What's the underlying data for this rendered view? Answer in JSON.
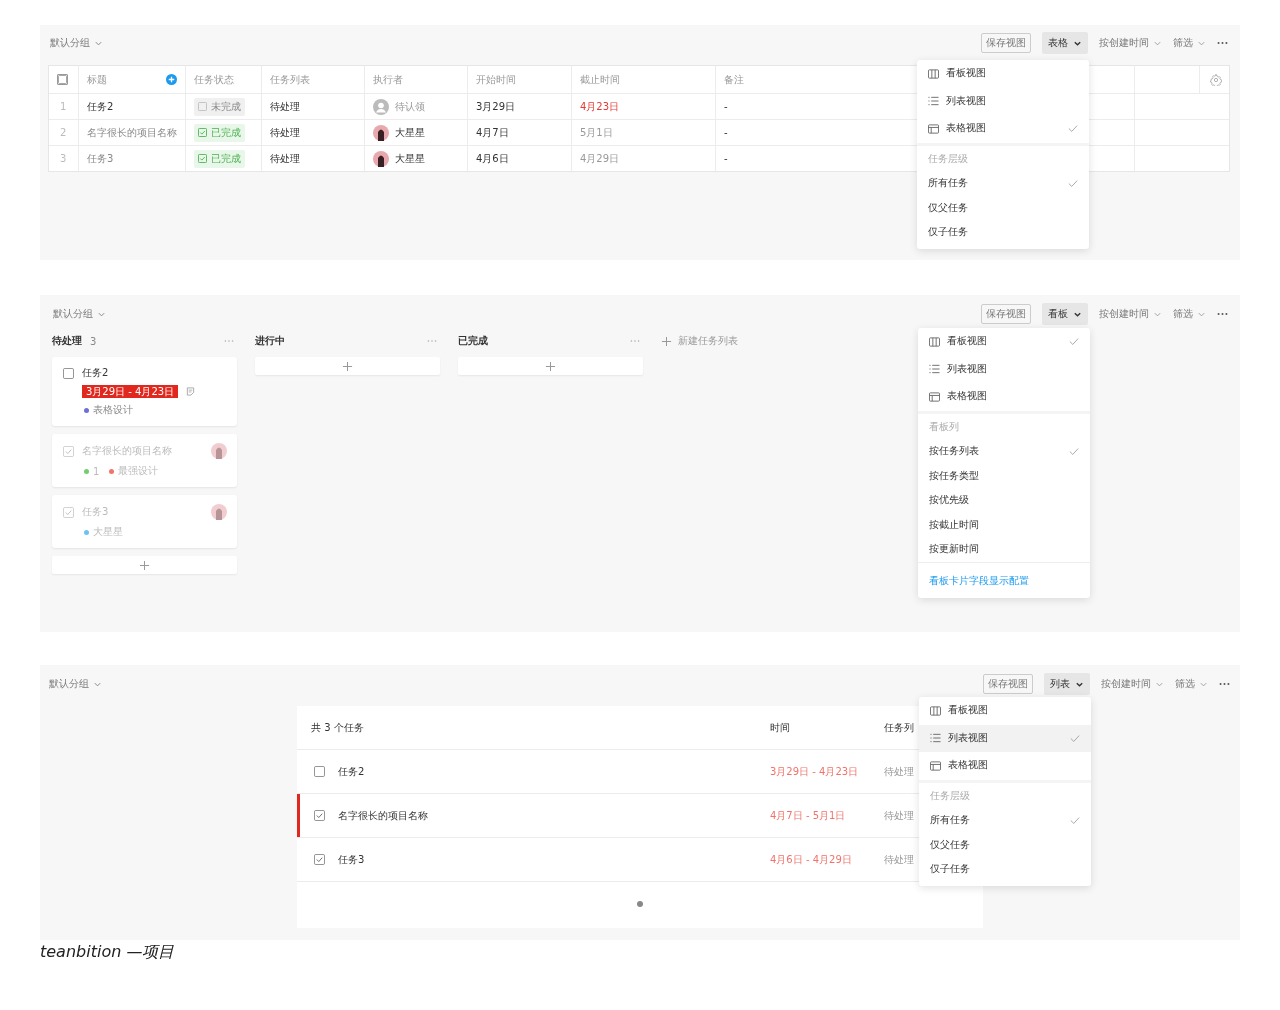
{
  "panels": [
    {
      "kind": "table",
      "group_label": "默认分组",
      "toolbar": {
        "save_view": "保存视图",
        "view": "表格",
        "sort": "按创建时间",
        "filter": "筛选"
      },
      "menu": {
        "sections": [
          {
            "items": [
              {
                "kind": "board",
                "label": "看板视图",
                "checked": false,
                "hovered": false
              },
              {
                "kind": "list",
                "label": "列表视图",
                "checked": false,
                "hovered": false
              },
              {
                "kind": "table",
                "label": "表格视图",
                "checked": true,
                "hovered": false
              }
            ]
          },
          {
            "header": "任务层级",
            "items": [
              {
                "label": "所有任务",
                "checked": true,
                "hovered": false
              },
              {
                "label": "仅父任务",
                "checked": false,
                "hovered": false
              },
              {
                "label": "仅子任务",
                "checked": false,
                "hovered": false
              }
            ]
          }
        ]
      },
      "table": {
        "select_all_checked": false,
        "columns": [
          "标题",
          "任务状态",
          "任务列表",
          "执行者",
          "开始时间",
          "截止时间",
          "备注"
        ],
        "rows": [
          {
            "index": "1",
            "title": "任务2",
            "done": false,
            "status": "未完成",
            "list": "待处理",
            "assignee": {
              "name": "待认领",
              "kind": "unclaimed"
            },
            "start": "3月29日",
            "due": "4月23日",
            "overdue": true,
            "note": "-"
          },
          {
            "index": "2",
            "title": "名字很长的项目名称",
            "done": true,
            "status": "已完成",
            "list": "待处理",
            "assignee": {
              "name": "大星星",
              "kind": "user"
            },
            "start": "4月7日",
            "due": "5月1日",
            "overdue": false,
            "note": "-"
          },
          {
            "index": "3",
            "title": "任务3",
            "done": true,
            "status": "已完成",
            "list": "待处理",
            "assignee": {
              "name": "大星星",
              "kind": "user"
            },
            "start": "4月6日",
            "due": "4月29日",
            "overdue": false,
            "note": "-"
          }
        ]
      }
    },
    {
      "kind": "board",
      "group_label": "默认分组",
      "toolbar": {
        "save_view": "保存视图",
        "view": "看板",
        "sort": "按创建时间",
        "filter": "筛选"
      },
      "menu": {
        "sections": [
          {
            "items": [
              {
                "kind": "board",
                "label": "看板视图",
                "checked": true,
                "hovered": false
              },
              {
                "kind": "list",
                "label": "列表视图",
                "checked": false,
                "hovered": false
              },
              {
                "kind": "table",
                "label": "表格视图",
                "checked": false,
                "hovered": false
              }
            ]
          },
          {
            "header": "看板列",
            "items": [
              {
                "label": "按任务列表",
                "checked": true,
                "hovered": false
              },
              {
                "label": "按任务类型",
                "checked": false,
                "hovered": false
              },
              {
                "label": "按优先级",
                "checked": false,
                "hovered": false
              },
              {
                "label": "按截止时间",
                "checked": false,
                "hovered": false
              },
              {
                "label": "按更新时间",
                "checked": false,
                "hovered": false
              }
            ]
          }
        ],
        "link": "看板卡片字段显示配置"
      },
      "board": {
        "new_list": "新建任务列表",
        "columns": [
          {
            "title": "待处理",
            "count": "3",
            "cards": [
              {
                "title": "任务2",
                "done": false,
                "date": "3月29日 - 4月23日",
                "note_icon": true,
                "avatar": false,
                "tags": [
                  {
                    "label": "表格设计",
                    "color": "#6b6fd6"
                  }
                ]
              },
              {
                "title": "名字很长的项目名称",
                "done": true,
                "note_icon": false,
                "avatar": true,
                "tags": [
                  {
                    "label": "1",
                    "color": "#6fcf6f"
                  },
                  {
                    "label": "最强设计",
                    "color": "#f2736a"
                  }
                ]
              },
              {
                "title": "任务3",
                "done": true,
                "note_icon": false,
                "avatar": true,
                "tags": [
                  {
                    "label": "大星星",
                    "color": "#6ec1f5"
                  }
                ]
              }
            ]
          },
          {
            "title": "进行中"
          },
          {
            "title": "已完成"
          }
        ]
      }
    },
    {
      "kind": "list",
      "group_label": "默认分组",
      "toolbar": {
        "save_view": "保存视图",
        "view": "列表",
        "sort": "按创建时间",
        "filter": "筛选"
      },
      "menu": {
        "sections": [
          {
            "items": [
              {
                "kind": "board",
                "label": "看板视图",
                "checked": false,
                "hovered": false
              },
              {
                "kind": "list",
                "label": "列表视图",
                "checked": true,
                "hovered": true
              },
              {
                "kind": "table",
                "label": "表格视图",
                "checked": false,
                "hovered": false
              }
            ]
          },
          {
            "header": "任务层级",
            "items": [
              {
                "label": "所有任务",
                "checked": true,
                "hovered": false
              },
              {
                "label": "仅父任务",
                "checked": false,
                "hovered": false
              },
              {
                "label": "仅子任务",
                "checked": false,
                "hovered": false
              }
            ]
          }
        ]
      },
      "list": {
        "header": "共 3 个任务",
        "columns": [
          "时间",
          "任务列"
        ],
        "rows": [
          {
            "title": "任务2",
            "done": false,
            "flagged": false,
            "time": "3月29日 - 4月23日",
            "list": "待处理"
          },
          {
            "title": "名字很长的项目名称",
            "done": true,
            "flagged": true,
            "time": "4月7日 - 5月1日",
            "list": "待处理"
          },
          {
            "title": "任务3",
            "done": true,
            "flagged": false,
            "time": "4月6日 - 4月29日",
            "list": "待处理"
          }
        ]
      }
    }
  ],
  "caption": "teanbition —项目"
}
